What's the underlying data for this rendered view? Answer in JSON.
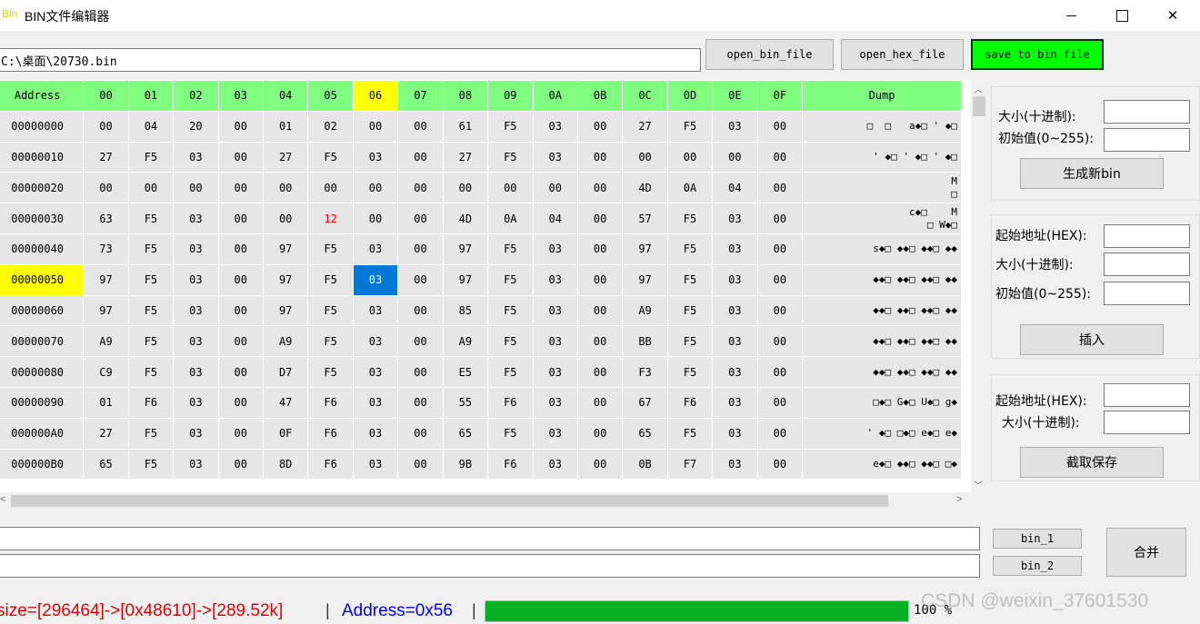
{
  "window": {
    "icon_text": "Bin",
    "title": "BIN文件编辑器"
  },
  "toolbar": {
    "path_value": "C:\\桌面\\20730.bin",
    "open_bin_label": "open_bin_file",
    "open_hex_label": "open_hex_file",
    "save_bin_label": "save to bin file"
  },
  "grid": {
    "headers": [
      "Address",
      "00",
      "01",
      "02",
      "03",
      "04",
      "05",
      "06",
      "07",
      "08",
      "09",
      "0A",
      "0B",
      "0C",
      "0D",
      "0E",
      "0F",
      "Dump"
    ],
    "highlighted_column": "06",
    "rows": [
      {
        "addr": "00000000",
        "bytes": [
          "00",
          "04",
          "20",
          "00",
          "01",
          "02",
          "00",
          "00",
          "61",
          "F5",
          "03",
          "00",
          "27",
          "F5",
          "03",
          "00"
        ],
        "dump": "□  □   a◆□ ' ◆□"
      },
      {
        "addr": "00000010",
        "bytes": [
          "27",
          "F5",
          "03",
          "00",
          "27",
          "F5",
          "03",
          "00",
          "27",
          "F5",
          "03",
          "00",
          "00",
          "00",
          "00",
          "00"
        ],
        "dump": "' ◆□ ' ◆□ ' ◆□"
      },
      {
        "addr": "00000020",
        "bytes": [
          "00",
          "00",
          "00",
          "00",
          "00",
          "00",
          "00",
          "00",
          "00",
          "00",
          "00",
          "00",
          "4D",
          "0A",
          "04",
          "00"
        ],
        "dump": "M\n□"
      },
      {
        "addr": "00000030",
        "bytes": [
          "63",
          "F5",
          "03",
          "00",
          "00",
          "12",
          "00",
          "00",
          "4D",
          "0A",
          "04",
          "00",
          "57",
          "F5",
          "03",
          "00"
        ],
        "dump": "c◆□    M\n□ W◆□"
      },
      {
        "addr": "00000040",
        "bytes": [
          "73",
          "F5",
          "03",
          "00",
          "97",
          "F5",
          "03",
          "00",
          "97",
          "F5",
          "03",
          "00",
          "97",
          "F5",
          "03",
          "00"
        ],
        "dump": "s◆□ ◆◆□ ◆◆□ ◆◆"
      },
      {
        "addr": "00000050",
        "bytes": [
          "97",
          "F5",
          "03",
          "00",
          "97",
          "F5",
          "03",
          "00",
          "97",
          "F5",
          "03",
          "00",
          "97",
          "F5",
          "03",
          "00"
        ],
        "dump": "◆◆□ ◆◆□ ◆◆□ ◆◆"
      },
      {
        "addr": "00000060",
        "bytes": [
          "97",
          "F5",
          "03",
          "00",
          "97",
          "F5",
          "03",
          "00",
          "85",
          "F5",
          "03",
          "00",
          "A9",
          "F5",
          "03",
          "00"
        ],
        "dump": "◆◆□ ◆◆□ ◆◆□ ◆◆"
      },
      {
        "addr": "00000070",
        "bytes": [
          "A9",
          "F5",
          "03",
          "00",
          "A9",
          "F5",
          "03",
          "00",
          "A9",
          "F5",
          "03",
          "00",
          "BB",
          "F5",
          "03",
          "00"
        ],
        "dump": "◆◆□ ◆◆□ ◆◆□ ◆◆"
      },
      {
        "addr": "00000080",
        "bytes": [
          "C9",
          "F5",
          "03",
          "00",
          "D7",
          "F5",
          "03",
          "00",
          "E5",
          "F5",
          "03",
          "00",
          "F3",
          "F5",
          "03",
          "00"
        ],
        "dump": "◆◆□ ◆◆□ ◆◆□ ◆◆"
      },
      {
        "addr": "00000090",
        "bytes": [
          "01",
          "F6",
          "03",
          "00",
          "47",
          "F6",
          "03",
          "00",
          "55",
          "F6",
          "03",
          "00",
          "67",
          "F6",
          "03",
          "00"
        ],
        "dump": "□◆□ G◆□ U◆□ g◆"
      },
      {
        "addr": "000000A0",
        "bytes": [
          "27",
          "F5",
          "03",
          "00",
          "0F",
          "F6",
          "03",
          "00",
          "65",
          "F5",
          "03",
          "00",
          "65",
          "F5",
          "03",
          "00"
        ],
        "dump": "' ◆□ □◆□ e◆□ e◆"
      },
      {
        "addr": "000000B0",
        "bytes": [
          "65",
          "F5",
          "03",
          "00",
          "8D",
          "F6",
          "03",
          "00",
          "9B",
          "F6",
          "03",
          "00",
          "0B",
          "F7",
          "03",
          "00"
        ],
        "dump": "e◆□ ◆◆□ ◆◆□ □◆"
      }
    ]
  },
  "panel_generate": {
    "size_label": "大小(十进制):",
    "init_label": "初始值(0~255):",
    "button": "生成新bin"
  },
  "panel_insert": {
    "start_label": "起始地址(HEX):",
    "size_label": "大小(十进制):",
    "init_label": "初始值(0~255):",
    "button": "插入"
  },
  "panel_extract": {
    "start_label": "起始地址(HEX):",
    "size_label": "大小(十进制):",
    "button": "截取保存"
  },
  "merge": {
    "bin1_label": "bin_1",
    "bin2_label": "bin_2",
    "merge_label": "合并"
  },
  "status": {
    "size_text": "size=[296464]->[0x48610]->[289.52k]",
    "separator": "|",
    "address_text": "Address=0x56",
    "progress": 1.0,
    "progress_text": "100 %"
  },
  "watermark": "CSDN @weixin_37601530",
  "colors": {
    "header_green": "#80ff80",
    "highlight_yellow": "#ffff00",
    "selection_blue": "#0078d7",
    "save_button_green": "#00ff00",
    "progress_green": "#06b025",
    "size_text_red": "#e00000",
    "address_text_blue": "#0000ee"
  }
}
